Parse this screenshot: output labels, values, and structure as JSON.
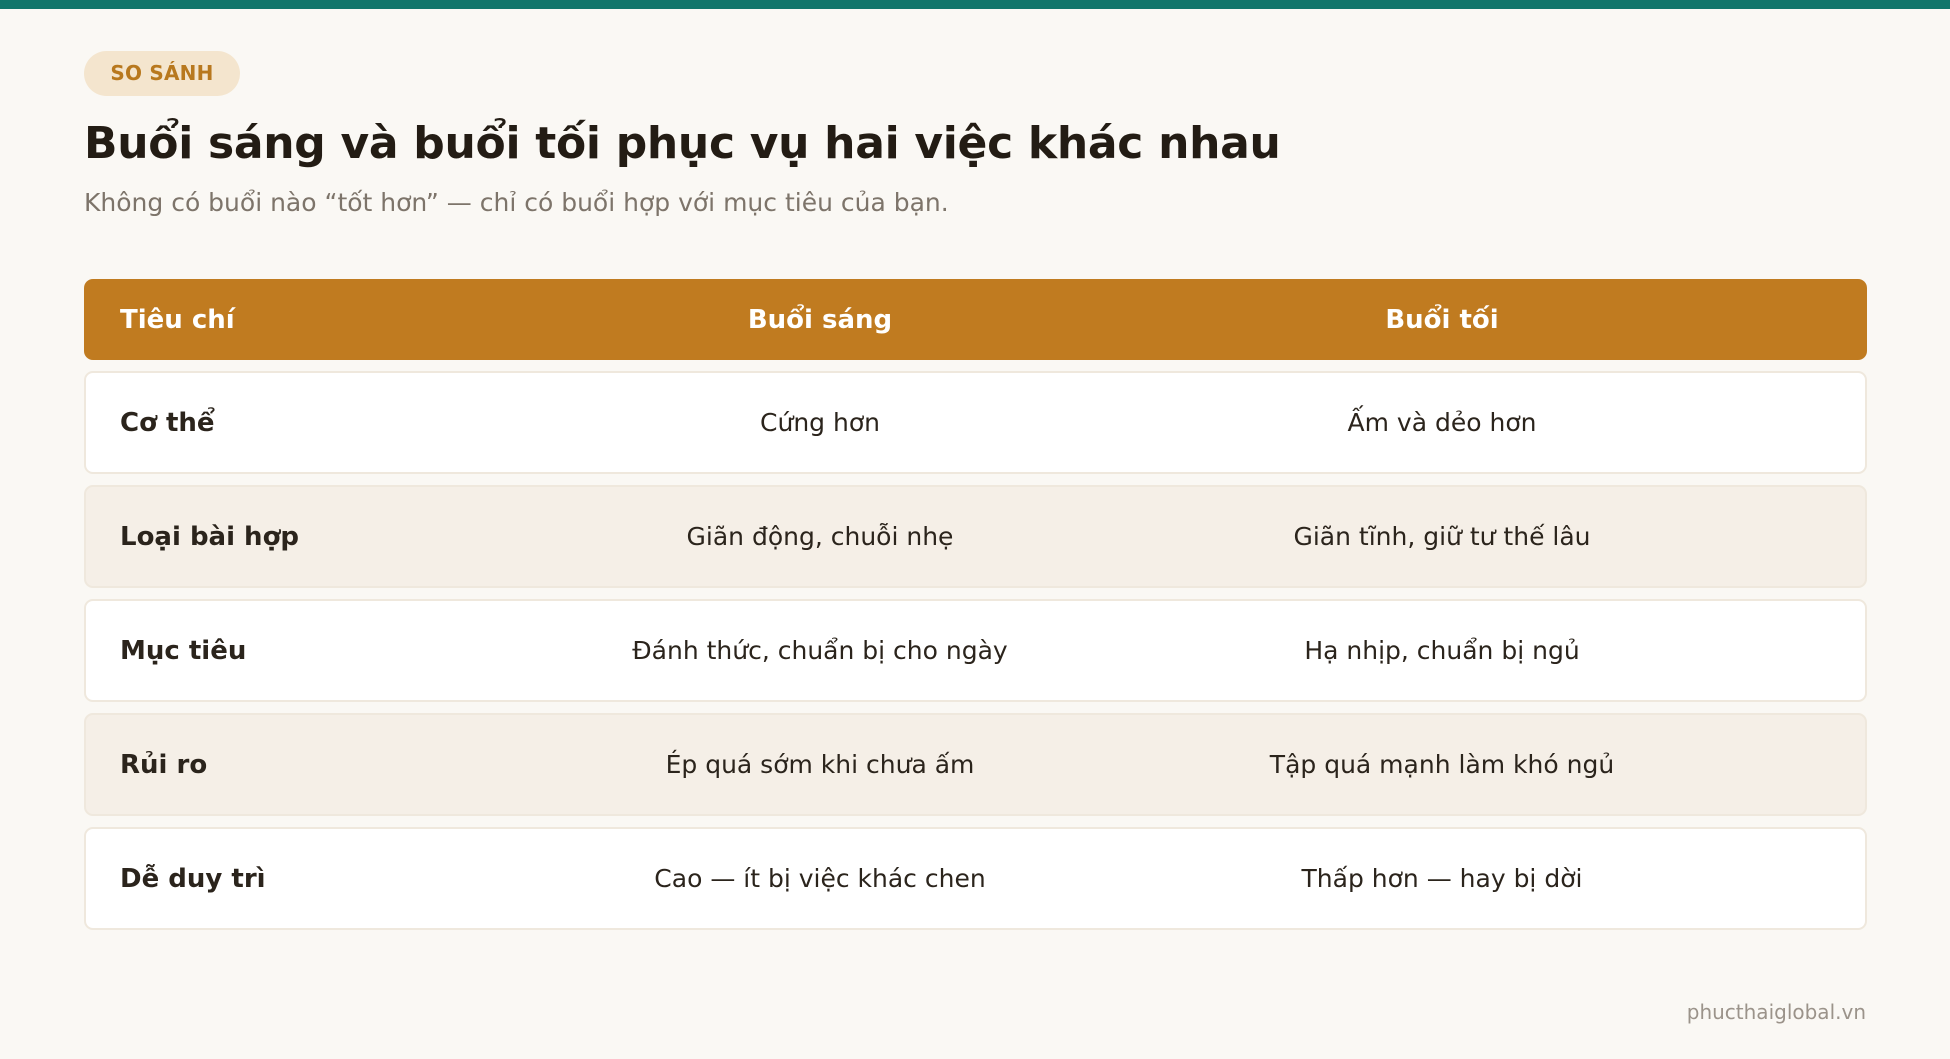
{
  "tag": "SO SÁNH",
  "title": "Buổi sáng và buổi tối phục vụ hai việc khác nhau",
  "subtitle": "Không có buổi nào “tốt hơn” — chỉ có buổi hợp với mục tiêu của bạn.",
  "table": {
    "headers": {
      "criteria": "Tiêu chí",
      "morning": "Buổi sáng",
      "evening": "Buổi tối"
    },
    "rows": [
      {
        "criteria": "Cơ thể",
        "morning": "Cứng hơn",
        "evening": "Ấm và dẻo hơn"
      },
      {
        "criteria": "Loại bài hợp",
        "morning": "Giãn động, chuỗi nhẹ",
        "evening": "Giãn tĩnh, giữ tư thế lâu"
      },
      {
        "criteria": "Mục tiêu",
        "morning": "Đánh thức, chuẩn bị cho ngày",
        "evening": "Hạ nhịp, chuẩn bị ngủ"
      },
      {
        "criteria": "Rủi ro",
        "morning": "Ép quá sớm khi chưa ấm",
        "evening": "Tập quá mạnh làm khó ngủ"
      },
      {
        "criteria": "Dễ duy trì",
        "morning": "Cao — ít bị việc khác chen",
        "evening": "Thấp hơn — hay bị dời"
      }
    ]
  },
  "footer": "phucthaiglobal.vn",
  "colors": {
    "accent_teal": "#12766b",
    "header_orange": "#c07b20",
    "tag_bg": "#f4e5ce",
    "tag_text": "#b8781e"
  }
}
